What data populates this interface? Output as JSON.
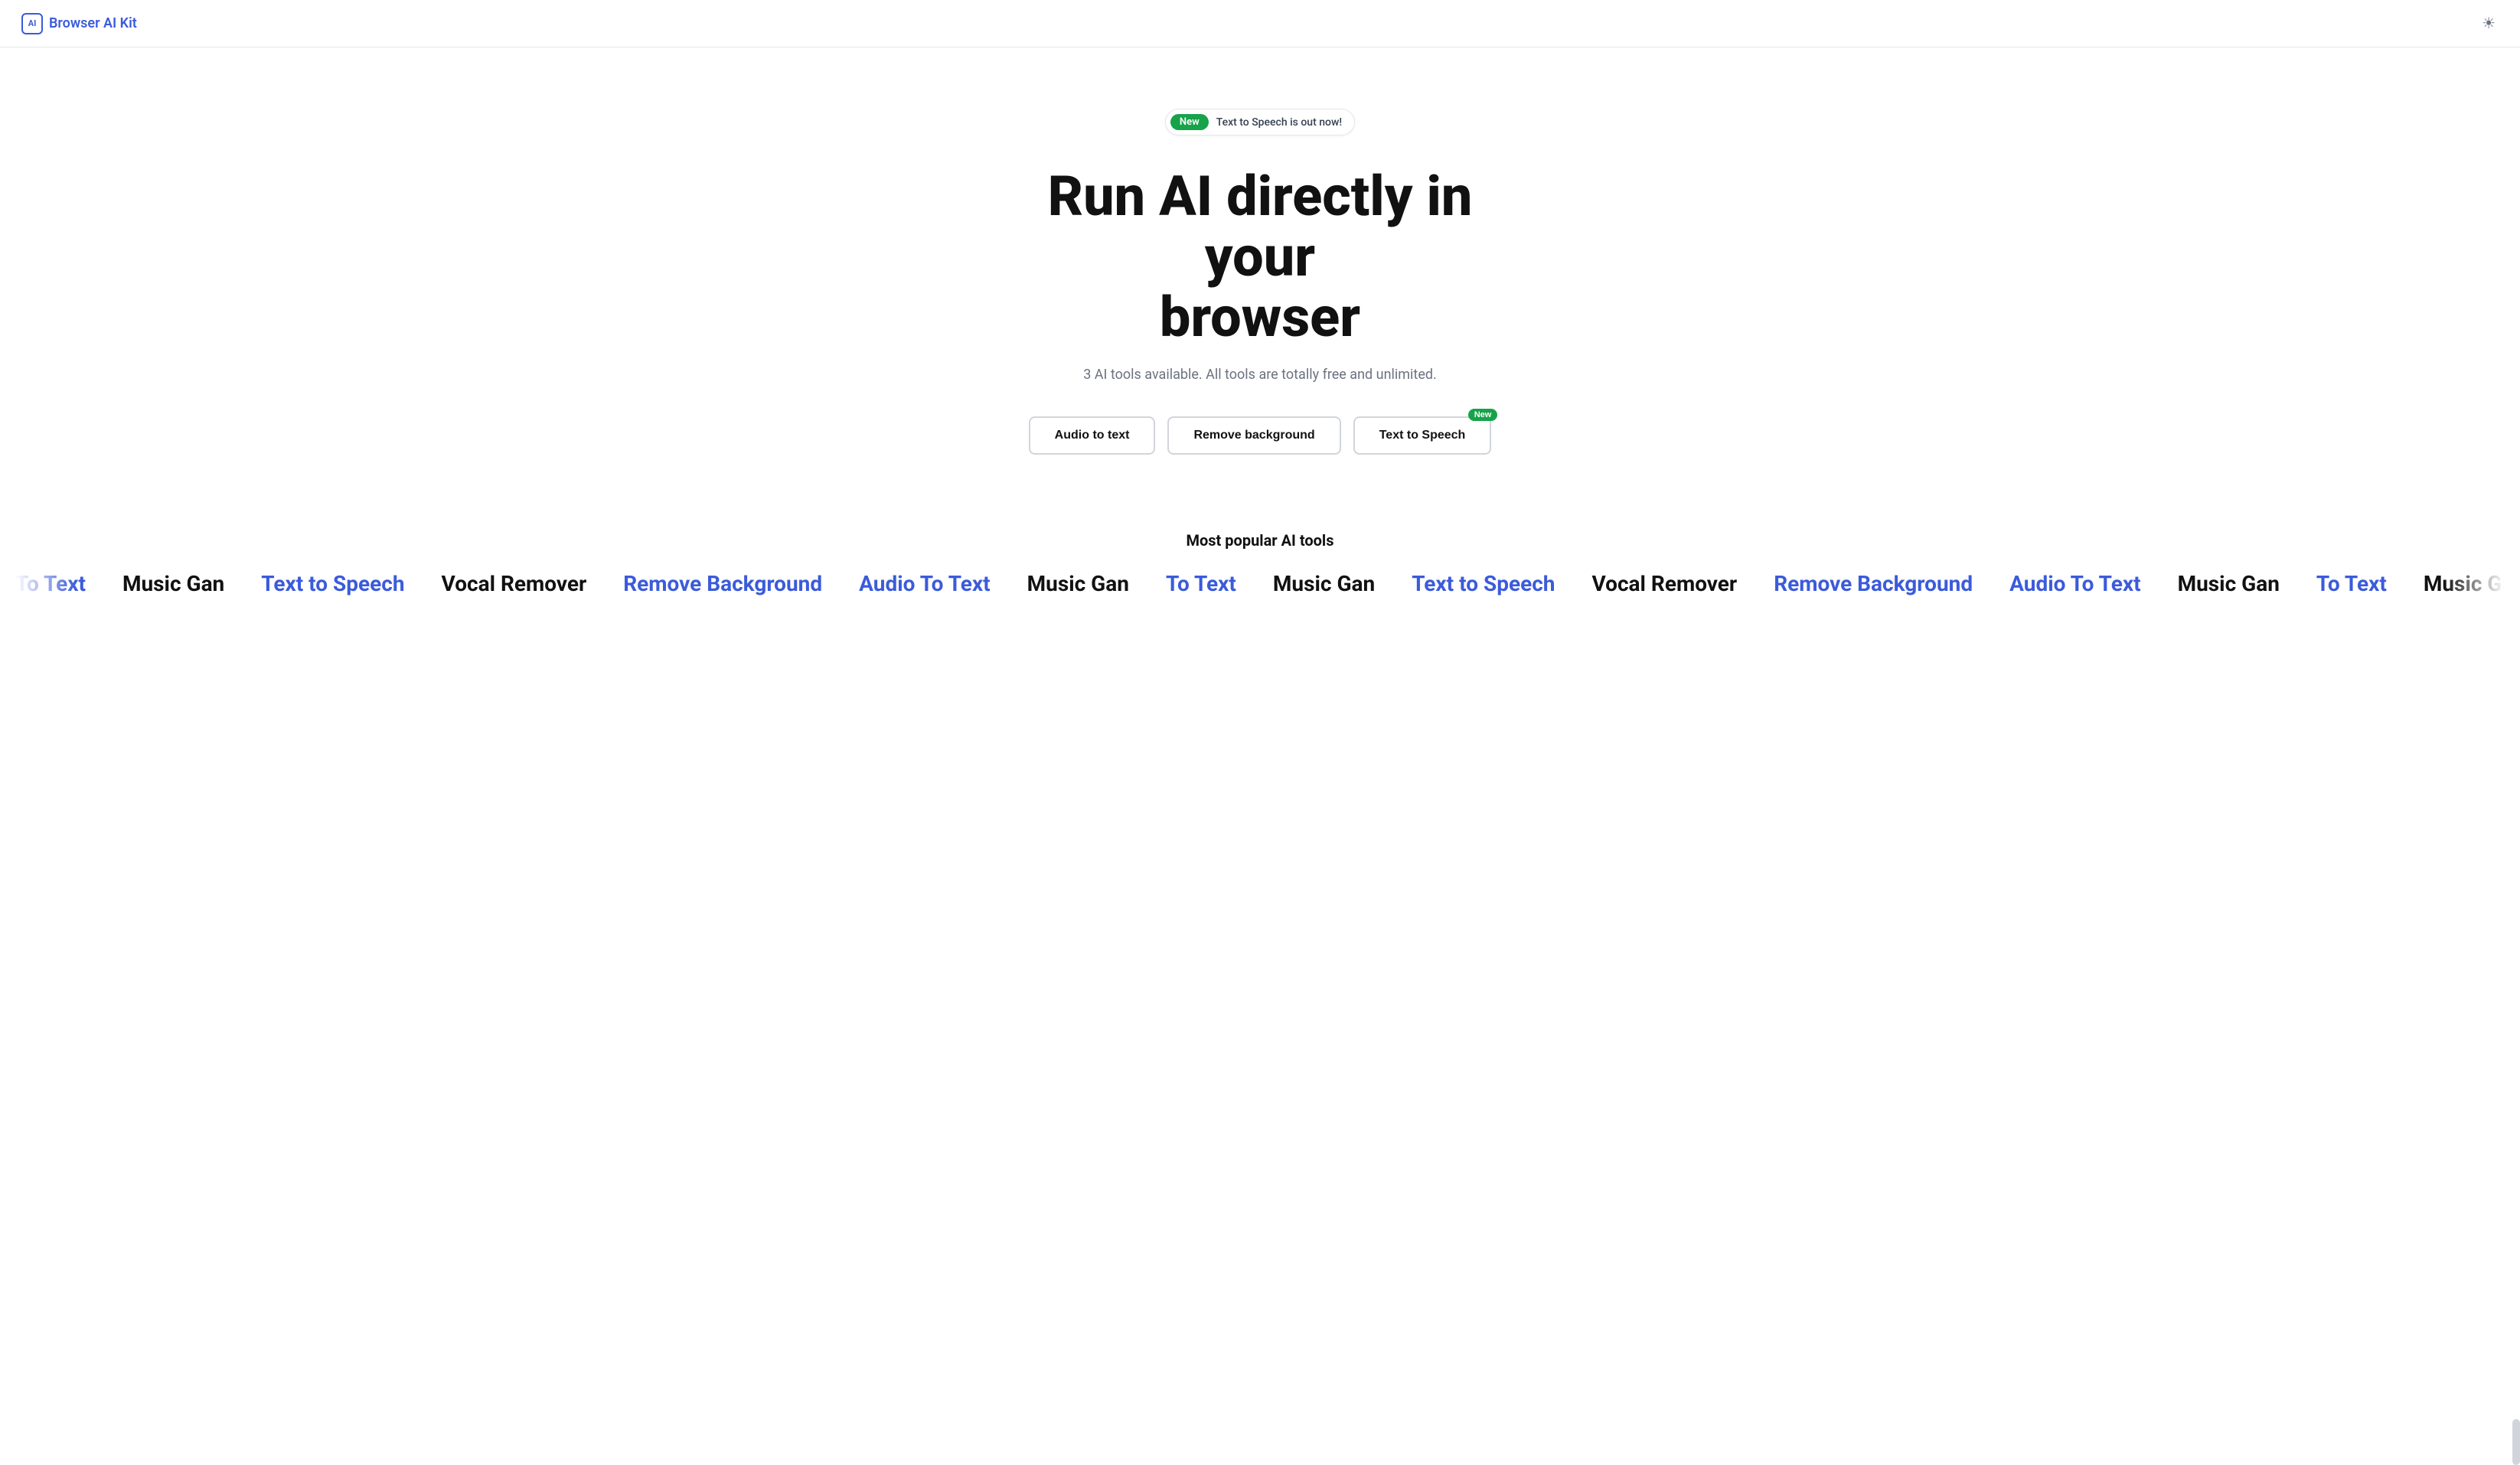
{
  "header": {
    "logo_icon": "AI",
    "logo_text": "Browser AI Kit",
    "theme_icon": "☀"
  },
  "announcement": {
    "badge": "New",
    "text": "Text to Speech is out now!"
  },
  "hero": {
    "heading_line1": "Run AI directly in your",
    "heading_line2": "browser",
    "subtext": "3 AI tools available. All tools are totally free and unlimited."
  },
  "cta_buttons": [
    {
      "label": "Audio to text",
      "new": false
    },
    {
      "label": "Remove background",
      "new": false
    },
    {
      "label": "Text to Speech",
      "new": true
    }
  ],
  "popular": {
    "title": "Most popular AI tools",
    "items": [
      {
        "label": "To Text",
        "color": "blue"
      },
      {
        "label": "Music Gan",
        "color": "black"
      },
      {
        "label": "Text to Speech",
        "color": "blue"
      },
      {
        "label": "Vocal Remover",
        "color": "black"
      },
      {
        "label": "Remove Background",
        "color": "blue"
      },
      {
        "label": "Audio To Text",
        "color": "blue"
      },
      {
        "label": "Music Gan",
        "color": "black"
      },
      {
        "label": "To Text",
        "color": "blue"
      },
      {
        "label": "Music Gan",
        "color": "black"
      },
      {
        "label": "Text to Speech",
        "color": "blue"
      },
      {
        "label": "Vocal Remover",
        "color": "black"
      },
      {
        "label": "Remove Background",
        "color": "blue"
      },
      {
        "label": "Audio To Text",
        "color": "blue"
      },
      {
        "label": "Music Gan",
        "color": "black"
      }
    ]
  }
}
